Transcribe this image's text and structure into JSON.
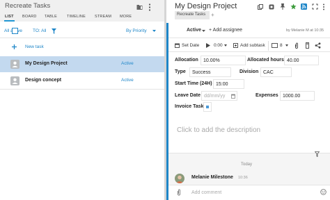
{
  "left": {
    "title": "Recreate Tasks",
    "tabs": [
      "LIST",
      "BOARD",
      "TABLE",
      "TIMELINE",
      "STREAM",
      "MORE"
    ],
    "filters": {
      "status": "All active",
      "to": "TO: All",
      "sort": "By Priority"
    },
    "new_task": "New task",
    "tasks": [
      {
        "name": "My Design Project",
        "status": "Active"
      },
      {
        "name": "Design concept",
        "status": "Active"
      }
    ]
  },
  "right": {
    "title": "My Design Project",
    "folder_tab": "Recreate Tasks",
    "add_folder": "+",
    "status": "Active",
    "add_assignee": "+ Add assignee",
    "author": "by Melanie M at 10:35",
    "toolbar": {
      "set_date": "Set Date",
      "timer": "0:00",
      "add_subtask": "Add subtask",
      "count": "8"
    },
    "fields": {
      "allocation_label": "Allocation",
      "allocation_value": "10.00%",
      "allocated_hours_label": "Allocated hours",
      "allocated_hours_value": "40.00",
      "type_label": "Type",
      "type_value": "Success",
      "division_label": "Division",
      "division_value": "CAC",
      "start_time_label": "Start Time (24H)",
      "start_time_value": "15:00",
      "leave_date_label": "Leave Date",
      "leave_date_placeholder": "dd/mm/yy",
      "expenses_label": "Expenses",
      "expenses_value": "1000.00",
      "invoice_tasks_label": "Invoice Tasks"
    },
    "description_placeholder": "Click to add the description",
    "activity": {
      "day": "Today",
      "user": "Melanie Milestone",
      "time": "10:36"
    },
    "comment_placeholder": "Add comment"
  },
  "colors": {
    "accent": "#1e86c8",
    "selected_row": "#c3d9ef",
    "header_bg": "#f0f0f0"
  }
}
